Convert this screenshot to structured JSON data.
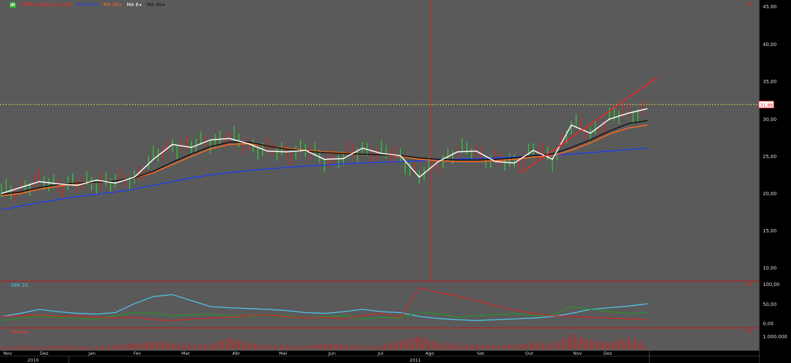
{
  "toolbar": {
    "logo_glyph": "dt",
    "symbol_label": "PETR4 (Diário) 31,88",
    "indicators": [
      {
        "label": "MA 200",
        "color": "#1a3cff"
      },
      {
        "label": "MA 45",
        "color": "#ff6a1a"
      },
      {
        "label": "MA 6",
        "color": "#ffffff"
      },
      {
        "label": "MA 40",
        "color": "#111111"
      }
    ],
    "caret_icon": "▾"
  },
  "price_axis": {
    "ticks": [
      "45,00",
      "40,00",
      "35,00",
      "30,00",
      "25,00",
      "20,00",
      "15,00",
      "10,00"
    ],
    "current_price_label": "31,88"
  },
  "dmi_panel": {
    "label": "DMI 10",
    "ticks": [
      "100,00",
      "50,00",
      "0,00"
    ]
  },
  "volume_panel": {
    "label": "Volume",
    "ticks": [
      "1.000.000"
    ]
  },
  "time_axis": {
    "months": [
      "Nov",
      "Dez",
      "Jan",
      "Fev",
      "Mar",
      "Abr",
      "Mai",
      "Jun",
      "Jul",
      "Ago",
      "Set",
      "Out",
      "Nov",
      "Dez"
    ],
    "years": [
      "2010",
      "2011"
    ]
  },
  "chart_data": {
    "type": "line",
    "price": {
      "ylim": [
        7.5,
        46.5
      ],
      "current_price": 31.88,
      "ma6": [
        20.2,
        21.0,
        21.8,
        21.5,
        21.3,
        22.0,
        21.6,
        22.4,
        24.8,
        26.8,
        26.4,
        27.4,
        27.6,
        26.9,
        25.9,
        25.8,
        26.0,
        24.8,
        24.9,
        26.3,
        25.6,
        25.3,
        22.4,
        24.5,
        25.8,
        25.9,
        24.5,
        24.3,
        26.0,
        24.8,
        29.4,
        28.3,
        30.2,
        31.0,
        31.6
      ],
      "ma40": [
        20.1,
        20.4,
        21.0,
        21.4,
        21.6,
        21.7,
        21.9,
        22.3,
        23.2,
        24.4,
        25.5,
        26.5,
        27.1,
        27.1,
        26.6,
        26.2,
        25.9,
        25.7,
        25.6,
        25.5,
        25.4,
        25.3,
        25.0,
        24.8,
        24.7,
        24.7,
        24.8,
        25.0,
        25.3,
        25.5,
        26.4,
        27.4,
        28.6,
        29.6,
        30.0
      ],
      "ma45": [
        19.9,
        20.2,
        20.8,
        21.2,
        21.5,
        21.7,
        21.9,
        22.3,
        23.0,
        24.1,
        25.2,
        26.2,
        26.8,
        26.9,
        26.6,
        26.3,
        26.0,
        25.8,
        25.7,
        25.5,
        25.4,
        25.2,
        24.8,
        24.6,
        24.5,
        24.5,
        24.6,
        24.8,
        25.1,
        25.3,
        26.0,
        27.0,
        28.2,
        29.0,
        29.4
      ],
      "ma200": [
        18.0,
        18.5,
        19.0,
        19.4,
        19.8,
        20.1,
        20.4,
        20.8,
        21.3,
        21.8,
        22.3,
        22.7,
        23.0,
        23.3,
        23.5,
        23.7,
        23.9,
        24.0,
        24.2,
        24.3,
        24.4,
        24.5,
        24.6,
        24.7,
        24.8,
        24.9,
        25.0,
        25.1,
        25.3,
        25.4,
        25.5,
        25.7,
        25.9,
        26.1,
        26.3
      ],
      "trendline": {
        "from": [
          0.805,
          23.0
        ],
        "to": [
          1.015,
          35.8
        ]
      }
    },
    "dmi": {
      "ylim": [
        -10,
        110
      ],
      "plus_di": [
        10,
        16,
        22,
        18,
        15,
        14,
        22,
        30,
        28,
        22,
        24,
        26,
        22,
        20,
        24,
        22,
        16,
        20,
        22,
        14,
        18,
        16,
        32,
        26,
        18,
        22,
        25,
        28,
        22,
        24,
        45,
        38,
        32,
        28,
        30
      ],
      "minus_di": [
        20,
        22,
        24,
        20,
        22,
        18,
        16,
        18,
        12,
        10,
        14,
        16,
        18,
        22,
        24,
        20,
        16,
        18,
        14,
        22,
        28,
        18,
        92,
        80,
        72,
        60,
        48,
        36,
        28,
        22,
        20,
        18,
        16,
        14,
        12
      ],
      "adx": [
        20,
        28,
        38,
        32,
        28,
        26,
        30,
        52,
        70,
        75,
        60,
        45,
        42,
        40,
        38,
        35,
        30,
        28,
        32,
        38,
        32,
        30,
        20,
        15,
        12,
        10,
        12,
        14,
        16,
        20,
        28,
        38,
        42,
        46,
        52
      ]
    },
    "volume": {
      "ylim": [
        0,
        1350000
      ],
      "values": [
        220000,
        260000,
        180000,
        300000,
        240000,
        200000,
        350000,
        420000,
        600000,
        520000,
        400000,
        380000,
        900000,
        450000,
        350000,
        300000,
        280000,
        420000,
        380000,
        260000,
        320000,
        650000,
        1000000,
        500000,
        420000,
        380000,
        300000,
        360000,
        520000,
        480000,
        1150000,
        700000,
        520000,
        900000,
        460000
      ]
    }
  }
}
